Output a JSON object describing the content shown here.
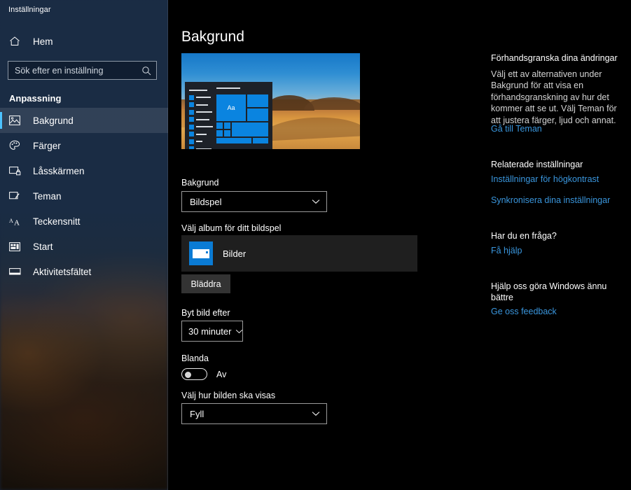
{
  "window": {
    "title": "Inställningar"
  },
  "sidebar": {
    "home": {
      "label": "Hem",
      "icon": "home-icon"
    },
    "search": {
      "placeholder": "Sök efter en inställning",
      "value": "",
      "icon": "search-icon"
    },
    "group_label": "Anpassning",
    "items": [
      {
        "label": "Bakgrund",
        "icon": "picture-icon",
        "selected": true
      },
      {
        "label": "Färger",
        "icon": "palette-icon",
        "selected": false
      },
      {
        "label": "Låsskärmen",
        "icon": "lock-screen-icon",
        "selected": false
      },
      {
        "label": "Teman",
        "icon": "theme-brush-icon",
        "selected": false
      },
      {
        "label": "Teckensnitt",
        "icon": "font-icon",
        "selected": false
      },
      {
        "label": "Start",
        "icon": "start-grid-icon",
        "selected": false
      },
      {
        "label": "Aktivitetsfältet",
        "icon": "taskbar-icon",
        "selected": false
      }
    ],
    "accent_color": "#4cc2ff"
  },
  "main": {
    "page_title": "Bakgrund",
    "preview": {
      "alt": "desert-wallpaper-preview",
      "tile_text": "Aa"
    },
    "background_field": {
      "label": "Bakgrund",
      "value": "Bildspel"
    },
    "album_field": {
      "label": "Välj album för ditt bildspel",
      "album_name": "Bilder",
      "browse_label": "Bläddra"
    },
    "interval_field": {
      "label": "Byt bild efter",
      "value": "30 minuter"
    },
    "shuffle_field": {
      "label": "Blanda",
      "state": "Av",
      "on": false
    },
    "fit_field": {
      "label": "Välj hur bilden ska visas",
      "value": "Fyll"
    }
  },
  "right_panel": {
    "preview_section": {
      "heading": "Förhandsgranska dina ändringar",
      "body": "Välj ett av alternativen under Bakgrund för att visa en förhandsgranskning av hur det kommer att se ut. Välj Teman för att justera färger, ljud och annat.",
      "link": "Gå till Teman"
    },
    "related_section": {
      "heading": "Relaterade inställningar",
      "link1": "Inställningar för högkontrast",
      "link2": "Synkronisera dina inställningar"
    },
    "question_section": {
      "heading": "Har du en fråga?",
      "link": "Få hjälp"
    },
    "feedback_section": {
      "heading": "Hjälp oss göra Windows ännu bättre",
      "link": "Ge oss feedback"
    },
    "link_color": "#3a96dd"
  }
}
